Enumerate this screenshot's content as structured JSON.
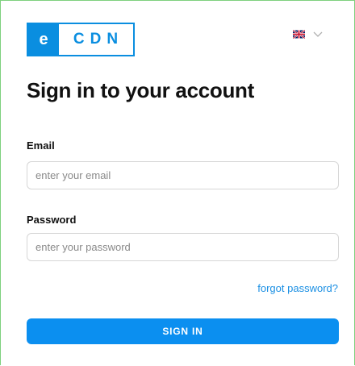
{
  "brand": {
    "logo_letter": "e",
    "logo_name": "CDN",
    "color": "#0a8ee0"
  },
  "language": {
    "current_icon": "uk-flag-icon",
    "dropdown_icon": "chevron-down-icon"
  },
  "page": {
    "title": "Sign in to your account"
  },
  "form": {
    "email_label": "Email",
    "email_placeholder": "enter your email",
    "email_value": "",
    "password_label": "Password",
    "password_placeholder": "enter your password",
    "password_value": "",
    "forgot_label": "forgot password?",
    "submit_label": "SIGN IN",
    "accent_color": "#0b8ff0"
  }
}
